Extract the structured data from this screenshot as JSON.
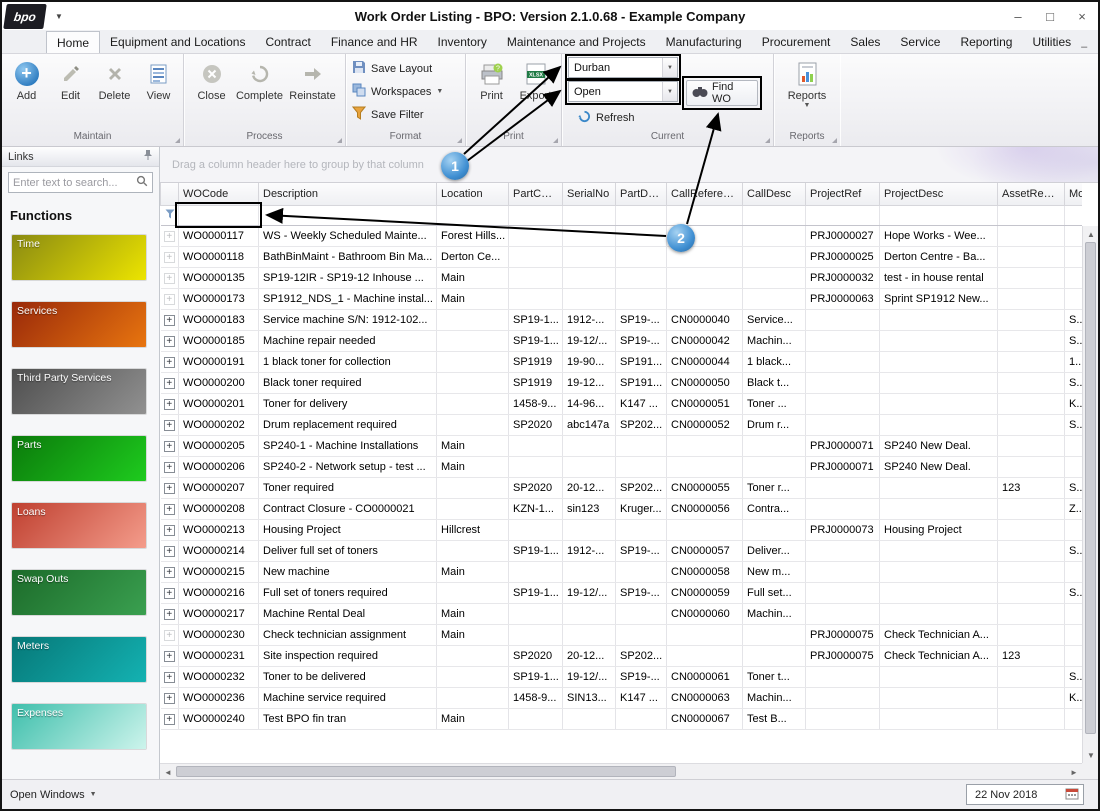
{
  "window": {
    "title": "Work Order Listing - BPO: Version 2.1.0.68 - Example Company",
    "logo": "bpo",
    "controls": {
      "minimize": "–",
      "maximize": "□",
      "close": "×"
    },
    "mdi_controls": {
      "minimize": "–",
      "restore": "□",
      "close": "×"
    }
  },
  "ribbon": {
    "tabs": [
      "Home",
      "Equipment and Locations",
      "Contract",
      "Finance and HR",
      "Inventory",
      "Maintenance and Projects",
      "Manufacturing",
      "Procurement",
      "Sales",
      "Service",
      "Reporting",
      "Utilities"
    ],
    "active_tab": "Home",
    "maintain": {
      "label": "Maintain",
      "add": "Add",
      "edit": "Edit",
      "delete": "Delete",
      "view": "View"
    },
    "process": {
      "label": "Process",
      "close": "Close",
      "complete": "Complete",
      "reinstate": "Reinstate"
    },
    "format": {
      "label": "Format",
      "save_layout": "Save Layout",
      "workspaces": "Workspaces",
      "save_filter": "Save Filter"
    },
    "print": {
      "label": "Print",
      "print": "Print",
      "export": "Export"
    },
    "current": {
      "label": "Current",
      "site": "Durban",
      "status": "Open",
      "find_wo": "Find WO",
      "refresh": "Refresh"
    },
    "reports": {
      "label": "Reports",
      "reports": "Reports"
    }
  },
  "sidebar": {
    "title": "Links",
    "search_placeholder": "Enter text to search...",
    "functions_label": "Functions",
    "tiles": [
      {
        "label": "Time",
        "from": "#8a8a12",
        "to": "#ece400"
      },
      {
        "label": "Services",
        "from": "#99290a",
        "to": "#e8750f"
      },
      {
        "label": "Third Party Services",
        "from": "#4e4e4e",
        "to": "#919191"
      },
      {
        "label": "Parts",
        "from": "#0b7a0b",
        "to": "#1ecb1e"
      },
      {
        "label": "Loans",
        "from": "#bf4030",
        "to": "#f49c8b"
      },
      {
        "label": "Swap Outs",
        "from": "#1c6b2a",
        "to": "#3aa050"
      },
      {
        "label": "Meters",
        "from": "#067878",
        "to": "#14b2b2"
      },
      {
        "label": "Expenses",
        "from": "#3fbfac",
        "to": "#cdf4ec"
      }
    ]
  },
  "grid": {
    "group_hint": "Drag a column header here to group by that column",
    "columns": [
      "WOCode",
      "Description",
      "Location",
      "PartCode",
      "SerialNo",
      "PartDesc",
      "CallReference",
      "CallDesc",
      "ProjectRef",
      "ProjectDesc",
      "AssetRegNo",
      "Model"
    ],
    "rows": [
      {
        "faded": true,
        "cells": [
          "WO0000117",
          "WS - Weekly Scheduled Mainte...",
          "Forest Hills...",
          "",
          "",
          "",
          "",
          "",
          "PRJ0000027",
          "Hope Works - Wee...",
          "",
          ""
        ]
      },
      {
        "faded": true,
        "cells": [
          "WO0000118",
          "BathBinMaint - Bathroom Bin Ma...",
          "Derton Ce...",
          "",
          "",
          "",
          "",
          "",
          "PRJ0000025",
          "Derton Centre - Ba...",
          "",
          ""
        ]
      },
      {
        "faded": true,
        "cells": [
          "WO0000135",
          "SP19-12IR - SP19-12 Inhouse ...",
          "Main",
          "",
          "",
          "",
          "",
          "",
          "PRJ0000032",
          "test - in house rental",
          "",
          ""
        ]
      },
      {
        "faded": true,
        "cells": [
          "WO0000173",
          "SP1912_NDS_1 - Machine instal...",
          "Main",
          "",
          "",
          "",
          "",
          "",
          "PRJ0000063",
          "Sprint SP1912 New...",
          "",
          ""
        ]
      },
      {
        "faded": false,
        "cells": [
          "WO0000183",
          "Service machine S/N: 1912-102...",
          "",
          "SP19-1...",
          "1912-...",
          "SP19-...",
          "CN0000040",
          "Service...",
          "",
          "",
          "",
          "S..."
        ]
      },
      {
        "faded": false,
        "cells": [
          "WO0000185",
          "Machine repair needed",
          "",
          "SP19-1...",
          "19-12/...",
          "SP19-...",
          "CN0000042",
          "Machin...",
          "",
          "",
          "",
          "S..."
        ]
      },
      {
        "faded": false,
        "cells": [
          "WO0000191",
          "1 black toner for collection",
          "",
          "SP1919",
          "19-90...",
          "SP191...",
          "CN0000044",
          "1 black...",
          "",
          "",
          "",
          "1..."
        ]
      },
      {
        "faded": false,
        "cells": [
          "WO0000200",
          "Black toner required",
          "",
          "SP1919",
          "19-12...",
          "SP191...",
          "CN0000050",
          "Black t...",
          "",
          "",
          "",
          "S..."
        ]
      },
      {
        "faded": false,
        "cells": [
          "WO0000201",
          "Toner for delivery",
          "",
          "1458-9...",
          "14-96...",
          "K147 ...",
          "CN0000051",
          "Toner ...",
          "",
          "",
          "",
          "K..."
        ]
      },
      {
        "faded": false,
        "cells": [
          "WO0000202",
          "Drum replacement required",
          "",
          "SP2020",
          "abc147a",
          "SP202...",
          "CN0000052",
          "Drum r...",
          "",
          "",
          "",
          "S..."
        ]
      },
      {
        "faded": false,
        "cells": [
          "WO0000205",
          "SP240-1 - Machine Installations",
          "Main",
          "",
          "",
          "",
          "",
          "",
          "PRJ0000071",
          "SP240 New Deal.",
          "",
          ""
        ]
      },
      {
        "faded": false,
        "cells": [
          "WO0000206",
          "SP240-2 - Network setup - test ...",
          "Main",
          "",
          "",
          "",
          "",
          "",
          "PRJ0000071",
          "SP240 New Deal.",
          "",
          ""
        ]
      },
      {
        "faded": false,
        "cells": [
          "WO0000207",
          "Toner required",
          "",
          "SP2020",
          "20-12...",
          "SP202...",
          "CN0000055",
          "Toner r...",
          "",
          "",
          "123",
          "S..."
        ]
      },
      {
        "faded": false,
        "cells": [
          "WO0000208",
          "Contract Closure - CO0000021",
          "",
          "KZN-1...",
          "sin123",
          "Kruger...",
          "CN0000056",
          "Contra...",
          "",
          "",
          "",
          "Z..."
        ]
      },
      {
        "faded": false,
        "cells": [
          "WO0000213",
          "Housing Project",
          "Hillcrest",
          "",
          "",
          "",
          "",
          "",
          "PRJ0000073",
          "Housing Project",
          "",
          ""
        ]
      },
      {
        "faded": false,
        "cells": [
          "WO0000214",
          "Deliver full set of toners",
          "",
          "SP19-1...",
          "1912-...",
          "SP19-...",
          "CN0000057",
          "Deliver...",
          "",
          "",
          "",
          "S..."
        ]
      },
      {
        "faded": false,
        "cells": [
          "WO0000215",
          "New machine",
          "Main",
          "",
          "",
          "",
          "CN0000058",
          "New m...",
          "",
          "",
          "",
          ""
        ]
      },
      {
        "faded": false,
        "cells": [
          "WO0000216",
          "Full set of toners required",
          "",
          "SP19-1...",
          "19-12/...",
          "SP19-...",
          "CN0000059",
          "Full set...",
          "",
          "",
          "",
          "S..."
        ]
      },
      {
        "faded": false,
        "cells": [
          "WO0000217",
          "Machine Rental Deal",
          "Main",
          "",
          "",
          "",
          "CN0000060",
          "Machin...",
          "",
          "",
          "",
          ""
        ]
      },
      {
        "faded": true,
        "cells": [
          "WO0000230",
          "Check technician assignment",
          "Main",
          "",
          "",
          "",
          "",
          "",
          "PRJ0000075",
          "Check Technician A...",
          "",
          ""
        ]
      },
      {
        "faded": false,
        "cells": [
          "WO0000231",
          "Site inspection required",
          "",
          "SP2020",
          "20-12...",
          "SP202...",
          "",
          "",
          "PRJ0000075",
          "Check Technician A...",
          "123",
          ""
        ]
      },
      {
        "faded": false,
        "cells": [
          "WO0000232",
          "Toner to be delivered",
          "",
          "SP19-1...",
          "19-12/...",
          "SP19-...",
          "CN0000061",
          "Toner t...",
          "",
          "",
          "",
          "S..."
        ]
      },
      {
        "faded": false,
        "cells": [
          "WO0000236",
          "Machine service required",
          "",
          "1458-9...",
          "SIN13...",
          "K147 ...",
          "CN0000063",
          "Machin...",
          "",
          "",
          "",
          "K..."
        ]
      },
      {
        "faded": false,
        "cells": [
          "WO0000240",
          "Test BPO fin tran",
          "Main",
          "",
          "",
          "",
          "CN0000067",
          "Test B...",
          "",
          "",
          "",
          ""
        ]
      }
    ]
  },
  "statusbar": {
    "open_windows": "Open Windows",
    "date": "22 Nov 2018"
  },
  "annotations": {
    "step1": "1",
    "step2": "2"
  }
}
